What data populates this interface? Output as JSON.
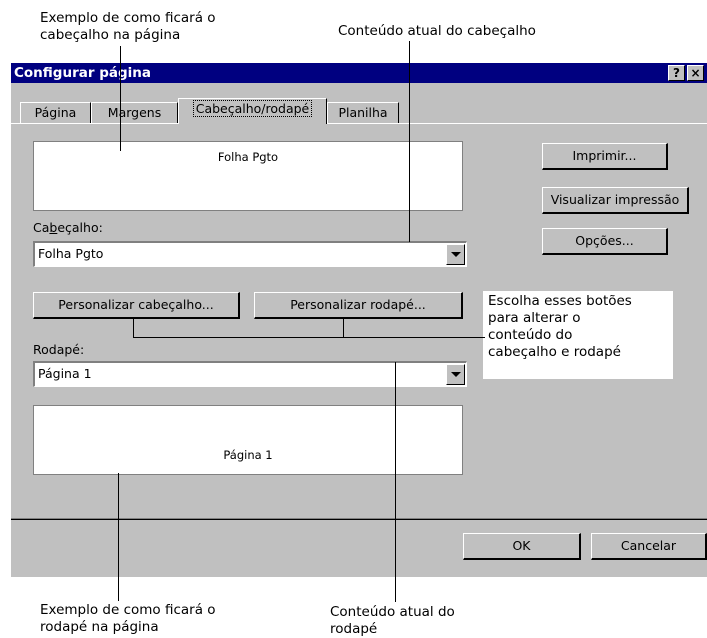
{
  "annotations": {
    "header_example": [
      "Exemplo de como ficará o",
      "cabeçalho na página"
    ],
    "header_content": "Conteúdo atual do cabeçalho",
    "buttons_note": [
      "Escolha esses botões",
      "para alterar o",
      "conteúdo do",
      "cabeçalho e rodapé"
    ],
    "footer_example": [
      "Exemplo de como ficará o",
      "rodapé na página"
    ],
    "footer_content": [
      "Conteúdo atual do",
      "rodapé"
    ]
  },
  "dialog": {
    "title": "Configurar página",
    "help_button": "?",
    "close_button": "×",
    "tabs": [
      {
        "label": "Página"
      },
      {
        "label": "Margens"
      },
      {
        "label": "Cabeçalho/rodapé",
        "active": true
      },
      {
        "label": "Planilha"
      }
    ],
    "header_preview": "Folha Pgto",
    "header_label": "Cabeçalho:",
    "header_value": "Folha Pgto",
    "custom_header_button": "Personalizar cabeçalho...",
    "custom_footer_button": "Personalizar rodapé...",
    "footer_label": "Rodapé:",
    "footer_value": "Página 1",
    "footer_preview": "Página 1",
    "side_buttons": {
      "print": "Imprimir...",
      "preview": "Visualizar impressão",
      "options": "Opções..."
    },
    "ok_button": "OK",
    "cancel_button": "Cancelar"
  }
}
